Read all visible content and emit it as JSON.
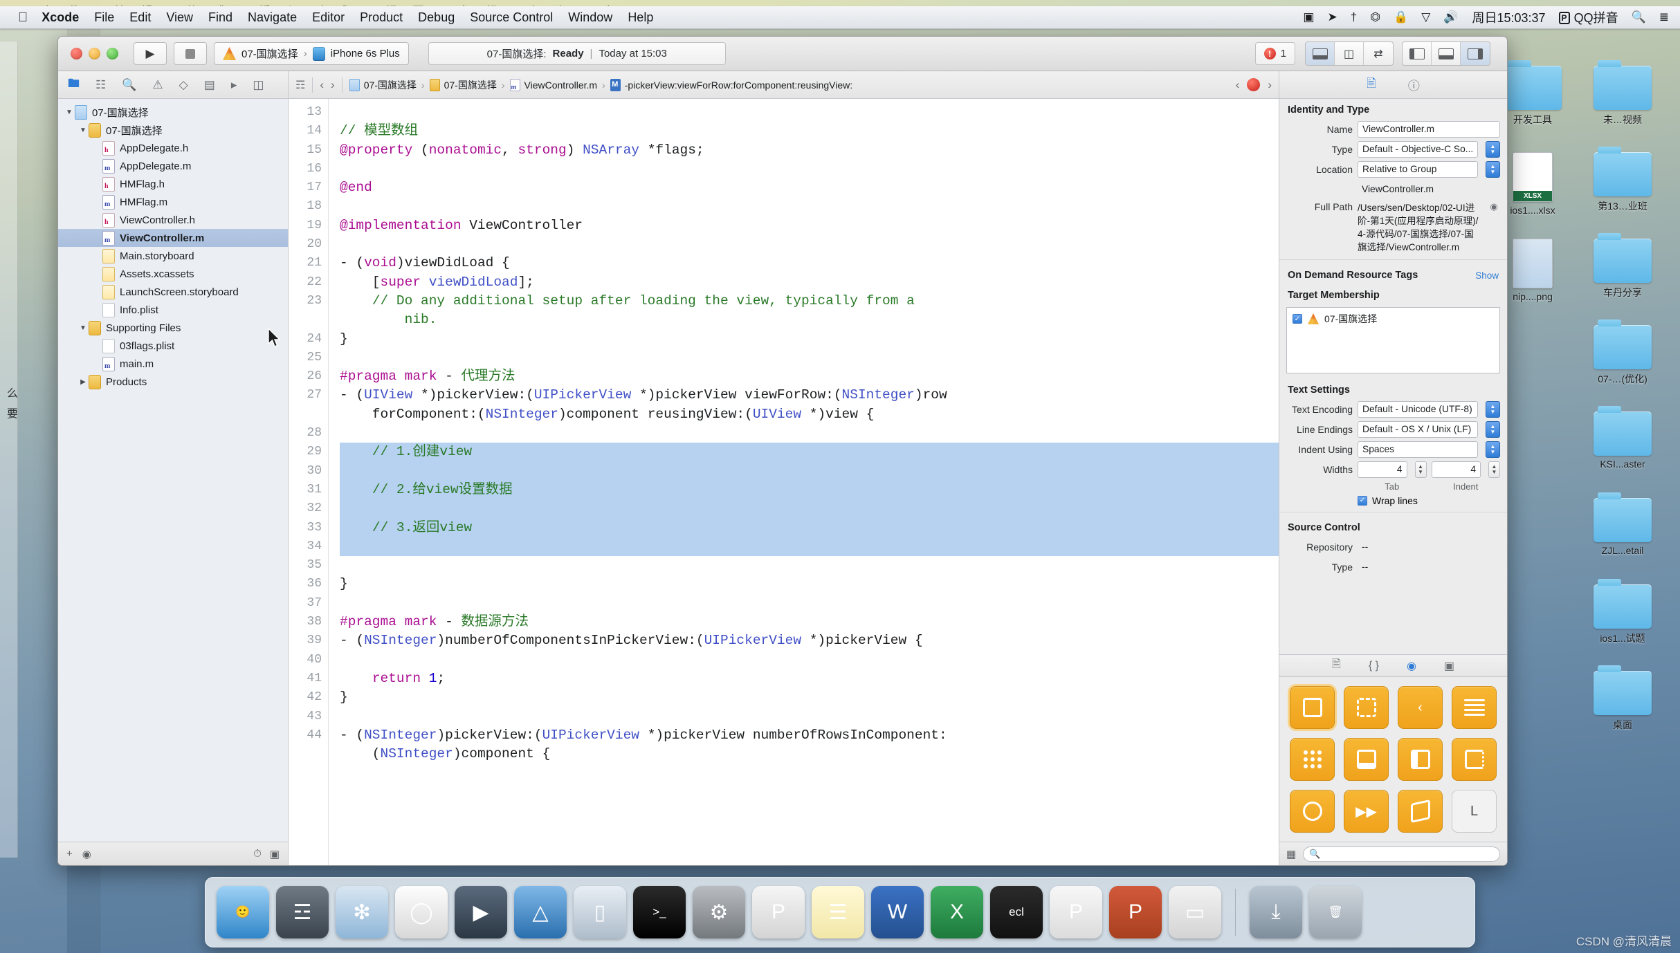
{
  "menubar": {
    "apple_icon": "apple-icon",
    "items": [
      "Xcode",
      "File",
      "Edit",
      "View",
      "Find",
      "Navigate",
      "Editor",
      "Product",
      "Debug",
      "Source Control",
      "Window",
      "Help"
    ],
    "right_icons": [
      "screen-record-icon",
      "location-arrow-icon",
      "bluetooth-share-icon",
      "bluetooth-icon",
      "lock-icon",
      "wifi-icon",
      "volume-icon"
    ],
    "clock": "周日15:03:37",
    "input_badge": "P",
    "input_method": "QQ拼音",
    "search_icon": "search-icon",
    "list_icon": "notification-center-icon"
  },
  "background_menu": "文件  编辑  格式  插入对象  视图  音频  幻灯  窗口",
  "toolbar": {
    "run_icon": "play-icon",
    "stop_icon": "stop-icon",
    "scheme_name": "07-国旗选择",
    "scheme_icon": "xcode-scheme-icon",
    "device_icon": "iphone-icon",
    "device_name": "iPhone 6s Plus",
    "separator": "›",
    "status_target": "07-国旗选择:",
    "status_state": "Ready",
    "status_pipe": "|",
    "status_time": "Today at 15:03",
    "error_count": "1",
    "editor_segments": [
      "standard-editor-icon",
      "assistant-editor-icon",
      "version-editor-icon"
    ],
    "view_segments": [
      "navigator-toggle-icon",
      "debug-area-toggle-icon",
      "utilities-toggle-icon"
    ]
  },
  "navigator": {
    "tabs": [
      "project-navigator-icon",
      "symbol-navigator-icon",
      "find-navigator-icon",
      "issue-navigator-icon",
      "test-navigator-icon",
      "debug-navigator-icon",
      "breakpoint-navigator-icon",
      "report-navigator-icon"
    ],
    "active_tab": 0,
    "tree": [
      {
        "label": "07-国旗选择",
        "depth": 0,
        "kind": "proj",
        "twisty": "▼",
        "selected": false
      },
      {
        "label": "07-国旗选择",
        "depth": 1,
        "kind": "dir",
        "twisty": "▼",
        "selected": false
      },
      {
        "label": "AppDelegate.h",
        "depth": 2,
        "kind": "h",
        "twisty": "",
        "selected": false
      },
      {
        "label": "AppDelegate.m",
        "depth": 2,
        "kind": "m",
        "twisty": "",
        "selected": false
      },
      {
        "label": "HMFlag.h",
        "depth": 2,
        "kind": "h",
        "twisty": "",
        "selected": false
      },
      {
        "label": "HMFlag.m",
        "depth": 2,
        "kind": "m",
        "twisty": "",
        "selected": false
      },
      {
        "label": "ViewController.h",
        "depth": 2,
        "kind": "h",
        "twisty": "",
        "selected": false
      },
      {
        "label": "ViewController.m",
        "depth": 2,
        "kind": "m",
        "twisty": "",
        "selected": true
      },
      {
        "label": "Main.storyboard",
        "depth": 2,
        "kind": "sb",
        "twisty": "",
        "selected": false
      },
      {
        "label": "Assets.xcassets",
        "depth": 2,
        "kind": "ac",
        "twisty": "",
        "selected": false
      },
      {
        "label": "LaunchScreen.storyboard",
        "depth": 2,
        "kind": "sb",
        "twisty": "",
        "selected": false
      },
      {
        "label": "Info.plist",
        "depth": 2,
        "kind": "pl",
        "twisty": "",
        "selected": false
      },
      {
        "label": "Supporting Files",
        "depth": 1,
        "kind": "dir",
        "twisty": "▼",
        "selected": false
      },
      {
        "label": "03flags.plist",
        "depth": 2,
        "kind": "pl",
        "twisty": "",
        "selected": false
      },
      {
        "label": "main.m",
        "depth": 2,
        "kind": "m",
        "twisty": "",
        "selected": false
      },
      {
        "label": "Products",
        "depth": 1,
        "kind": "dir",
        "twisty": "▶",
        "selected": false
      }
    ],
    "footer": {
      "add": "+",
      "filter": "filter-icon",
      "recent": "recent-icon",
      "unsaved": "unsaved-icon"
    }
  },
  "jumpbar": {
    "related_icon": "related-items-icon",
    "back_icon": "‹",
    "forward_icon": "›",
    "crumbs": [
      {
        "label": "07-国旗选择",
        "kind": "proj"
      },
      {
        "label": "07-国旗选择",
        "kind": "dir"
      },
      {
        "label": "ViewController.m",
        "kind": "m"
      },
      {
        "label": "-pickerView:viewForRow:forComponent:reusingView:",
        "kind": "mth"
      }
    ],
    "separator": "›",
    "prev_issue": "‹",
    "error_icon": "error-icon",
    "next_issue": "›"
  },
  "code": {
    "first_line": 13,
    "error_line": 36,
    "lines": [
      {
        "n": 13,
        "html": "",
        "hl": false
      },
      {
        "n": 14,
        "html": "<span class='cm'>// 模型数组</span>",
        "hl": false
      },
      {
        "n": 15,
        "html": "<span class='k'>@property</span> (<span class='k'>nonatomic</span>, <span class='k'>strong</span>) <span class='ty'>NSArray</span> *flags;",
        "hl": false
      },
      {
        "n": 16,
        "html": "",
        "hl": false
      },
      {
        "n": 17,
        "html": "<span class='k'>@end</span>",
        "hl": false
      },
      {
        "n": 18,
        "html": "",
        "hl": false
      },
      {
        "n": 19,
        "html": "<span class='k'>@implementation</span> ViewController",
        "hl": false
      },
      {
        "n": 20,
        "html": "",
        "hl": false
      },
      {
        "n": 21,
        "html": "- (<span class='k'>void</span>)viewDidLoad {",
        "hl": false
      },
      {
        "n": 22,
        "html": "    [<span class='k'>super</span> <span class='ty'>viewDidLoad</span>];",
        "hl": false
      },
      {
        "n": 23,
        "html": "    <span class='cm'>// Do any additional setup after loading the view, typically from a</span>",
        "hl": false
      },
      {
        "n": "",
        "html": "        <span class='cm'>nib.</span>",
        "hl": false
      },
      {
        "n": 24,
        "html": "}",
        "hl": false
      },
      {
        "n": 25,
        "html": "",
        "hl": false
      },
      {
        "n": 26,
        "html": "<span class='pre'>#pragma mark</span> - <span class='cm'>代理方法</span>",
        "hl": false
      },
      {
        "n": 27,
        "html": "- (<span class='ty'>UIView</span> *)pickerView:(<span class='ty'>UIPickerView</span> *)pickerView viewForRow:(<span class='ty'>NSInteger</span>)row",
        "hl": false
      },
      {
        "n": "",
        "html": "    forComponent:(<span class='ty'>NSInteger</span>)component reusingView:(<span class='ty'>UIView</span> *)view {",
        "hl": false
      },
      {
        "n": 28,
        "html": "",
        "hl": false
      },
      {
        "n": 29,
        "html": "    <span class='cm'>// 1.创建view</span>",
        "hl": true
      },
      {
        "n": 30,
        "html": "",
        "hl": true
      },
      {
        "n": 31,
        "html": "    <span class='cm'>// 2.给view设置数据</span>",
        "hl": true
      },
      {
        "n": 32,
        "html": "",
        "hl": true
      },
      {
        "n": 33,
        "html": "    <span class='cm'>// 3.返回view</span>",
        "hl": true
      },
      {
        "n": 34,
        "html": "",
        "hl": true
      },
      {
        "n": 35,
        "html": "",
        "hl": false
      },
      {
        "n": 36,
        "html": "}",
        "hl": false
      },
      {
        "n": 37,
        "html": "",
        "hl": false
      },
      {
        "n": 38,
        "html": "<span class='pre'>#pragma mark</span> - <span class='cm'>数据源方法</span>",
        "hl": false
      },
      {
        "n": 39,
        "html": "- (<span class='ty'>NSInteger</span>)numberOfComponentsInPickerView:(<span class='ty'>UIPickerView</span> *)pickerView {",
        "hl": false
      },
      {
        "n": 40,
        "html": "",
        "hl": false
      },
      {
        "n": 41,
        "html": "    <span class='k'>return</span> <span class='num'>1</span>;",
        "hl": false
      },
      {
        "n": 42,
        "html": "}",
        "hl": false
      },
      {
        "n": 43,
        "html": "",
        "hl": false
      },
      {
        "n": 44,
        "html": "- (<span class='ty'>NSInteger</span>)pickerView:(<span class='ty'>UIPickerView</span> *)pickerView numberOfRowsInComponent:",
        "hl": false
      },
      {
        "n": "",
        "html": "    (<span class='ty'>NSInteger</span>)component {",
        "hl": false
      }
    ]
  },
  "inspector": {
    "tabs": [
      "file-inspector-icon",
      "quick-help-icon"
    ],
    "active_tab": 0,
    "identity": {
      "title": "Identity and Type",
      "name_label": "Name",
      "name_value": "ViewController.m",
      "type_label": "Type",
      "type_value": "Default - Objective-C So...",
      "location_label": "Location",
      "location_value": "Relative to Group",
      "location_file": "ViewController.m",
      "fullpath_label": "Full Path",
      "fullpath_value": "/Users/sen/Desktop/02-UI进阶-第1天(应用程序启动原理)/4-源代码/07-国旗选择/07-国旗选择/ViewController.m"
    },
    "ondemand": {
      "title": "On Demand Resource Tags",
      "link": "Show"
    },
    "target_membership": {
      "title": "Target Membership",
      "items": [
        {
          "label": "07-国旗选择",
          "checked": true
        }
      ]
    },
    "text_settings": {
      "title": "Text Settings",
      "encoding_label": "Text Encoding",
      "encoding_value": "Default - Unicode (UTF-8)",
      "endings_label": "Line Endings",
      "endings_value": "Default - OS X / Unix (LF)",
      "indent_label": "Indent Using",
      "indent_value": "Spaces",
      "widths_label": "Widths",
      "tab_value": "4",
      "indent_value_num": "4",
      "tab_caption": "Tab",
      "indent_caption": "Indent",
      "wrap_label": "Wrap lines",
      "wrap_checked": true
    },
    "source_control": {
      "title": "Source Control",
      "repository_label": "Repository",
      "repository_value": "--",
      "type_label": "Type",
      "type_value": "--"
    }
  },
  "library": {
    "tabs": [
      "file-template-library-icon",
      "code-snippet-library-icon",
      "object-library-icon",
      "media-library-icon"
    ],
    "active_tab": 2,
    "objects": [
      {
        "name": "view-controller-object",
        "glyph": "sq",
        "selected": true
      },
      {
        "name": "storyboard-reference-object",
        "glyph": "sqd",
        "selected": false
      },
      {
        "name": "navigation-controller-object",
        "glyph": "‹",
        "selected": false
      },
      {
        "name": "table-view-controller-object",
        "glyph": "lines",
        "selected": false
      },
      {
        "name": "collection-view-controller-object",
        "glyph": "dots",
        "selected": false
      },
      {
        "name": "tab-bar-controller-object",
        "glyph": "tabbar",
        "selected": false
      },
      {
        "name": "split-view-controller-object",
        "glyph": "split",
        "selected": false
      },
      {
        "name": "page-view-controller-object",
        "glyph": "page",
        "selected": false
      },
      {
        "name": "gl-kit-view-controller-object",
        "glyph": "circle",
        "selected": false
      },
      {
        "name": "av-kit-player-controller-object",
        "glyph": "▶▶",
        "selected": false
      },
      {
        "name": "object-cube",
        "glyph": "cube",
        "selected": false
      },
      {
        "name": "label-object",
        "glyph": "L",
        "selected": false,
        "plain": true
      }
    ],
    "footer": {
      "grid_icon": "grid-view-icon",
      "search_icon": "search-icon",
      "search_placeholder": ""
    }
  },
  "desktop": {
    "items": [
      {
        "label": "开发工具",
        "kind": "folder"
      },
      {
        "label": "未…视频",
        "kind": "folder"
      },
      {
        "label": "ios1....xlsx",
        "kind": "xlsx"
      },
      {
        "label": "第13…业班",
        "kind": "folder"
      },
      {
        "label": "nip....png",
        "kind": "png"
      },
      {
        "label": "车丹分享",
        "kind": "folder"
      },
      {
        "label": "07-…(优化)",
        "kind": "folder"
      },
      {
        "label": "KSI...aster",
        "kind": "folder"
      },
      {
        "label": "ZJL...etail",
        "kind": "folder"
      },
      {
        "label": "ios1...试题",
        "kind": "folder"
      },
      {
        "label": "桌面",
        "kind": "folder"
      }
    ]
  },
  "dock": {
    "items": [
      {
        "name": "finder",
        "color1": "#9fd2f5",
        "color2": "#2f86c9",
        "glyph": "🙂"
      },
      {
        "name": "launchpad",
        "color1": "#6f7a85",
        "color2": "#3a434d",
        "glyph": "☲"
      },
      {
        "name": "safari",
        "color1": "#d8e6f2",
        "color2": "#8fb6d8",
        "glyph": "❇"
      },
      {
        "name": "mouse-app",
        "color1": "#fdfdfd",
        "color2": "#d8d8d8",
        "glyph": "◯"
      },
      {
        "name": "video-app",
        "color1": "#5b6b7d",
        "color2": "#2b3744",
        "glyph": "▶"
      },
      {
        "name": "xcode",
        "color1": "#7fb8e8",
        "color2": "#2a6fae",
        "glyph": "△"
      },
      {
        "name": "simulator",
        "color1": "#e8eef4",
        "color2": "#aebdcb",
        "glyph": "▯"
      },
      {
        "name": "terminal",
        "color1": "#2b2b2b",
        "color2": "#000000",
        "glyph": ">_"
      },
      {
        "name": "system-preferences",
        "color1": "#b9bdc2",
        "color2": "#74797e",
        "glyph": "⚙"
      },
      {
        "name": "pycharm",
        "color1": "#f5f5f5",
        "color2": "#d4d4d4",
        "glyph": "P"
      },
      {
        "name": "notes",
        "color1": "#fff9d6",
        "color2": "#f2e7a8",
        "glyph": "☰"
      },
      {
        "name": "word",
        "color1": "#3b72c4",
        "color2": "#24508f",
        "glyph": "W"
      },
      {
        "name": "excel",
        "color1": "#3fae62",
        "color2": "#1d7a3c",
        "glyph": "X"
      },
      {
        "name": "eclipse",
        "color1": "#2b2b2b",
        "color2": "#111111",
        "glyph": "ecl"
      },
      {
        "name": "keynote",
        "color1": "#f7f7f7",
        "color2": "#dcdcdc",
        "glyph": "P"
      },
      {
        "name": "powerpoint",
        "color1": "#d2593b",
        "color2": "#a8401f",
        "glyph": "P"
      },
      {
        "name": "docs",
        "color1": "#f2f2f2",
        "color2": "#d4d4d4",
        "glyph": "▭"
      },
      {
        "name": "downloads-stack",
        "color1": "#b9c6d2",
        "color2": "#7f8e9c",
        "glyph": "⤓"
      },
      {
        "name": "trash",
        "color1": "#cfd6dc",
        "color2": "#9aa5b0",
        "glyph": "🗑"
      }
    ]
  },
  "watermark": "CSDN @清风清晨"
}
